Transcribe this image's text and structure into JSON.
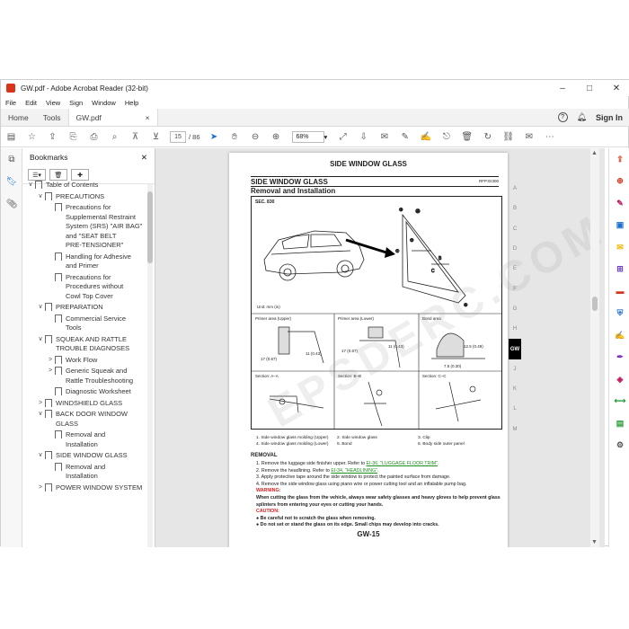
{
  "window": {
    "title": "GW.pdf - Adobe Acrobat Reader (32-bit)",
    "controls": [
      "–",
      "□",
      "✕"
    ]
  },
  "menu": [
    "File",
    "Edit",
    "View",
    "Sign",
    "Window",
    "Help"
  ],
  "tabs": {
    "home": "Home",
    "tools": "Tools",
    "doc": "GW.pdf",
    "doc_close": "×",
    "signin": "Sign In"
  },
  "toolbar": {
    "page_current": "15",
    "page_total": "/ 86",
    "zoom": "68%",
    "icons": [
      "save-icon",
      "star-icon",
      "upload-icon",
      "share-icon",
      "print-icon",
      "search-icon",
      "prev-page-icon",
      "next-page-icon",
      "select-cursor-icon",
      "hand-icon",
      "zoom-out-icon",
      "zoom-in-icon",
      "fit-icon",
      "scroll-icon",
      "comment-icon",
      "highlight-icon",
      "sign-icon",
      "stamp-icon",
      "delete-icon",
      "link-icon",
      "email-icon",
      "more-icon"
    ]
  },
  "bookmarks": {
    "title": "Bookmarks",
    "close": "✕",
    "options": "☰▾",
    "items": [
      {
        "level": 0,
        "toggle": "∨",
        "label": "Table of Contents"
      },
      {
        "level": 1,
        "toggle": "∨",
        "label": "PRECAUTIONS"
      },
      {
        "level": 2,
        "toggle": "",
        "label": "Precautions for\nSupplemental Restraint\nSystem (SRS) \"AIR BAG\"\nand \"SEAT BELT\nPRE-TENSIONER\""
      },
      {
        "level": 2,
        "toggle": "",
        "label": "Handling for Adhesive\nand Primer"
      },
      {
        "level": 2,
        "toggle": "",
        "label": "Precautions for\nProcedures without\nCowl Top Cover"
      },
      {
        "level": 1,
        "toggle": "∨",
        "label": "PREPARATION"
      },
      {
        "level": 2,
        "toggle": "",
        "label": "Commercial Service\nTools"
      },
      {
        "level": 1,
        "toggle": "∨",
        "label": "SQUEAK AND RATTLE\nTROUBLE DIAGNOSES"
      },
      {
        "level": 2,
        "toggle": ">",
        "label": "Work Flow"
      },
      {
        "level": 2,
        "toggle": ">",
        "label": "Generic Squeak and\nRattle Troubleshooting"
      },
      {
        "level": 2,
        "toggle": "",
        "label": "Diagnostic Worksheet"
      },
      {
        "level": 1,
        "toggle": ">",
        "label": "WINDSHIELD GLASS"
      },
      {
        "level": 1,
        "toggle": "∨",
        "label": "BACK DOOR WINDOW\nGLASS"
      },
      {
        "level": 2,
        "toggle": "",
        "label": "Removal and\nInstallation"
      },
      {
        "level": 1,
        "toggle": "∨",
        "label": "SIDE WINDOW GLASS"
      },
      {
        "level": 2,
        "toggle": "",
        "label": "Removal and\nInstallation"
      },
      {
        "level": 1,
        "toggle": ">",
        "label": "POWER WINDOW SYSTEM"
      }
    ]
  },
  "page": {
    "header": "SIDE WINDOW GLASS",
    "section_title": "SIDE WINDOW GLASS",
    "subtitle": "Removal and Installation",
    "code": "RFP:EI300",
    "sec": "SEC. 830",
    "watermark": "EPSDERC.COM",
    "unit": "Unit: mm (in)",
    "primer_labels": [
      "Primer area (Upper)",
      "Primer area (Lower)",
      "Bond area"
    ],
    "section_labels": [
      "Section: A–A",
      "Section: B–B",
      "Section: C–C"
    ],
    "dims": [
      "17 (0.67)",
      "11 (0.43)",
      "17 (0.67)",
      "11 (0.43)",
      "12.5 (0.49)",
      "7.5 (0.30)"
    ],
    "legend": [
      [
        "1. Side window glass molding (Upper)",
        "2. Side window glass",
        "3. Clip"
      ],
      [
        "4. Side window glass molding (Lower)",
        "5. Bond",
        "6. Body side outer panel"
      ]
    ],
    "removal_title": "REMOVAL",
    "step1_a": "1. Remove the luggage side finisher upper. Refer to ",
    "step1_link": "EI-36, \"LUGGAGE FLOOR TRIM\"",
    "step1_b": ".",
    "step2_a": "2. Remove the headlining. Refer to ",
    "step2_link": "EI-34, \"HEADLINING\"",
    "step2_b": ".",
    "step3": "3. Apply protective tape around the side window to protect the painted surface from damage.",
    "step4": "4. Remove the side window glass using piano wire or power cutting tool and an inflatable pump bag.",
    "warning_label": "WARNING:",
    "warning_text": "When cutting the glass from the vehicle, always wear safety glasses and heavy gloves to help prevent glass splinters from entering your eyes or cutting your hands.",
    "caution_label": "CAUTION:",
    "caution1": "● Be careful not to scratch the glass when removing.",
    "caution2": "● Do not set or stand the glass on its edge. Small chips may develop into cracks.",
    "page_number": "GW-15"
  },
  "side_index": [
    "A",
    "B",
    "C",
    "D",
    "E",
    "F",
    "G",
    "H",
    "GW",
    "J",
    "K",
    "L",
    "M"
  ],
  "side_index_active": "GW",
  "right_tools": [
    "export-pdf-icon",
    "create-pdf-icon",
    "edit-pdf-icon",
    "combine-icon",
    "comment-tool-icon",
    "organize-icon",
    "redact-icon",
    "protect-icon",
    "fill-sign-icon",
    "send-sign-icon",
    "certificates-icon",
    "measure-icon",
    "print-production-icon",
    "tools-more-icon"
  ],
  "right_tool_glyphs": [
    "⇪",
    "⊕",
    "✎",
    "▣",
    "✉",
    "⊞",
    "▬",
    "⛨",
    "✍",
    "✒",
    "◈",
    "⟷",
    "▤",
    "⚙"
  ],
  "right_tool_colors": [
    "#d9341a",
    "#d9341a",
    "#c2185b",
    "#1a6fd1",
    "#f2b600",
    "#6a3fd1",
    "#d9341a",
    "#1a6fd1",
    "#7b2fbf",
    "#7b2fbf",
    "#c2185b",
    "#2e9e3a",
    "#2e9e3a",
    "#555555"
  ]
}
